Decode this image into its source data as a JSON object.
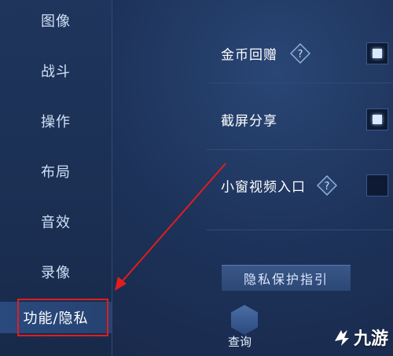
{
  "sidebar": {
    "items": [
      {
        "label": "图像"
      },
      {
        "label": "战斗"
      },
      {
        "label": "操作"
      },
      {
        "label": "布局"
      },
      {
        "label": "音效"
      },
      {
        "label": "录像"
      },
      {
        "label": "功能/隐私"
      }
    ]
  },
  "settings": [
    {
      "label": "金币回赠",
      "has_help": true,
      "checked": true
    },
    {
      "label": "截屏分享",
      "has_help": false,
      "checked": true
    },
    {
      "label": "小窗视频入口",
      "has_help": true,
      "checked": false
    }
  ],
  "privacy_button": {
    "label": "隐私保护指引"
  },
  "query_button": {
    "label": "查询"
  },
  "watermark": {
    "text": "九游"
  },
  "colors": {
    "highlight": "#e11d1d",
    "accent": "#dbe9ff",
    "background": "#1d3259"
  }
}
